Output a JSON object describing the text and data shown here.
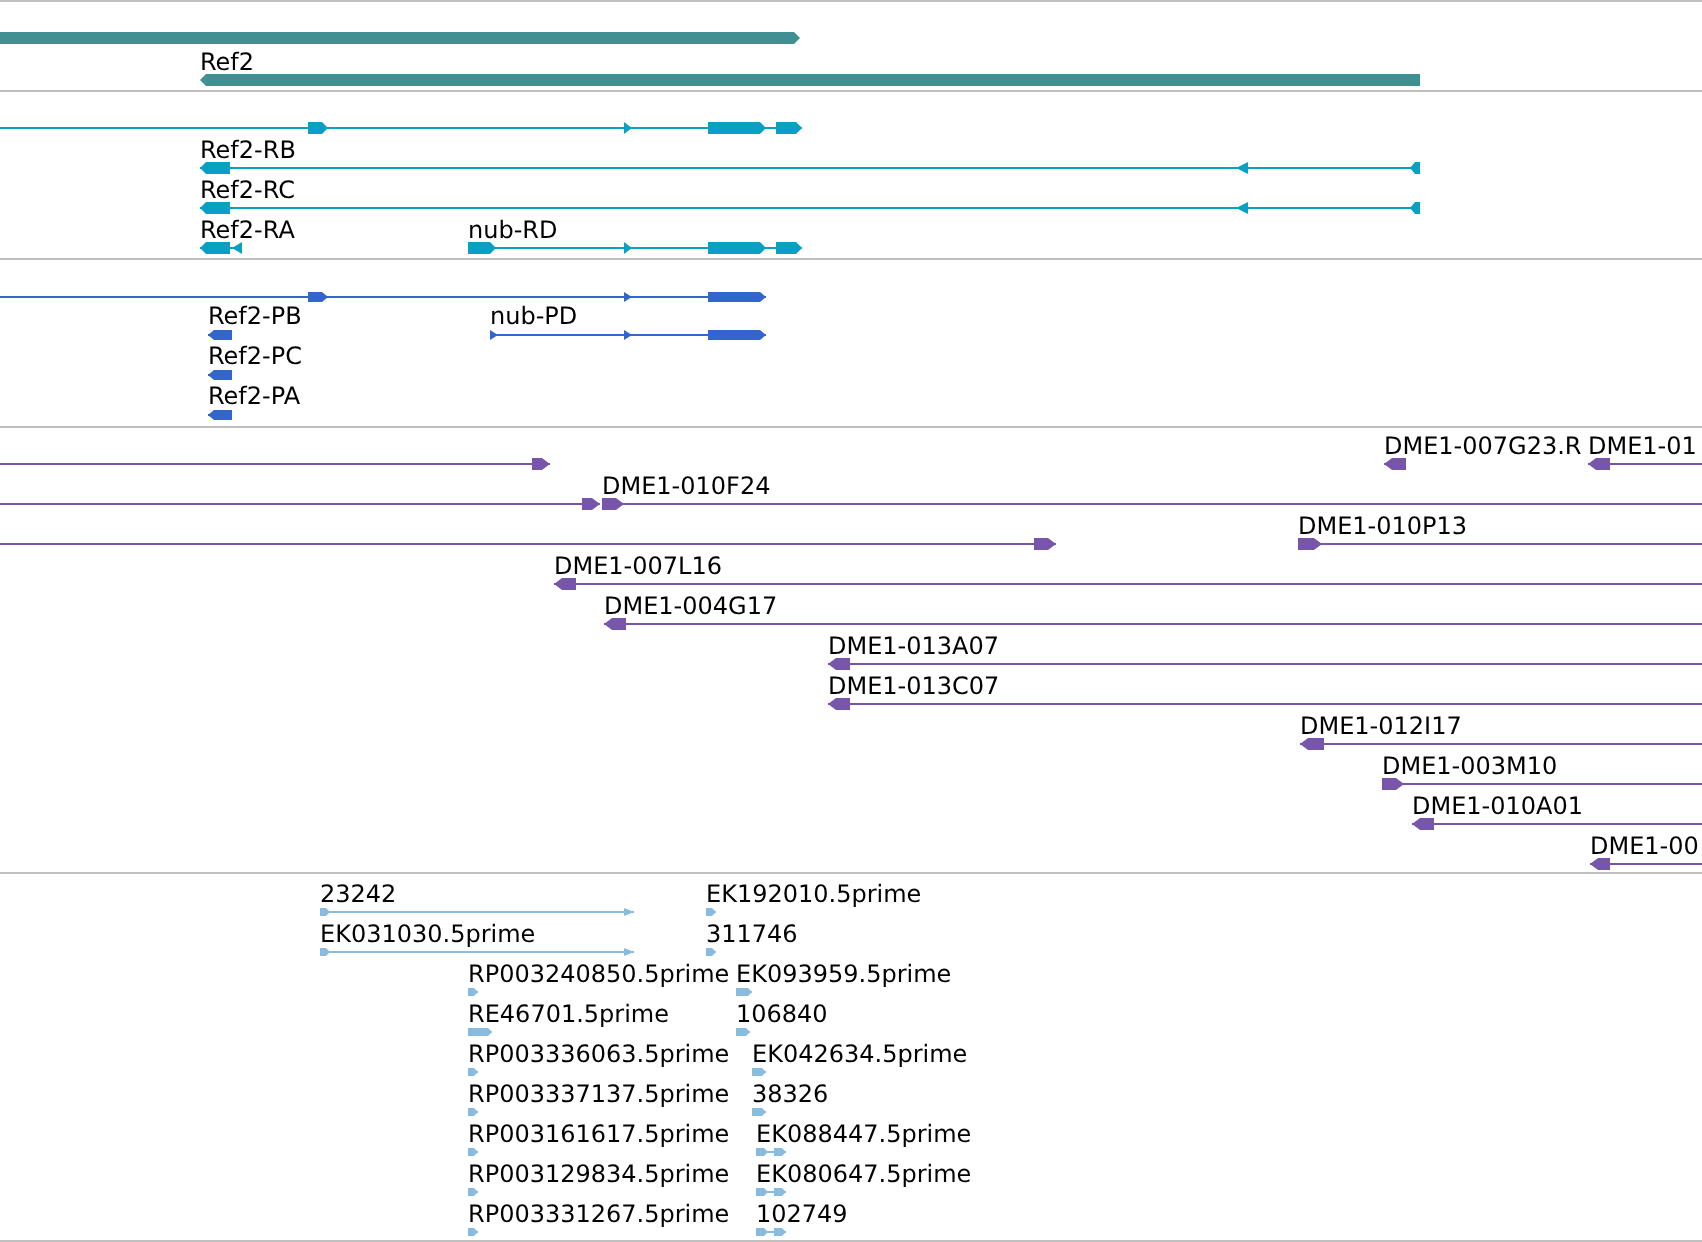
{
  "tracks": [
    {
      "kind": "gene",
      "color": "#408f93",
      "features": [
        {
          "reverse": false
        },
        {
          "label": "Ref2",
          "reverse": true
        }
      ]
    },
    {
      "kind": "transcript",
      "color": "#0aa0c4",
      "features": [
        {
          "reverse": false
        },
        {
          "label": "Ref2-RB",
          "reverse": true
        },
        {
          "label": "Ref2-RC",
          "reverse": true
        },
        {
          "label": "Ref2-RA",
          "reverse": true
        },
        {
          "label": "nub-RD",
          "reverse": false
        }
      ]
    },
    {
      "kind": "protein",
      "color": "#3366cc",
      "features": [
        {
          "reverse": false
        },
        {
          "label": "Ref2-PB",
          "reverse": true
        },
        {
          "label": "nub-PD",
          "reverse": false
        },
        {
          "label": "Ref2-PC",
          "reverse": true
        },
        {
          "label": "Ref2-PA",
          "reverse": true
        }
      ]
    },
    {
      "kind": "clone",
      "color": "#7755aa",
      "features": [
        {
          "reverse": false
        },
        {
          "label": "DME1-007G23.R",
          "reverse": true
        },
        {
          "label": "DME1-01",
          "reverse": true
        },
        {
          "reverse": false
        },
        {
          "label": "DME1-010F24",
          "reverse": false
        },
        {
          "reverse": false
        },
        {
          "label": "DME1-010P13",
          "reverse": false
        },
        {
          "label": "DME1-007L16",
          "reverse": true
        },
        {
          "label": "DME1-004G17",
          "reverse": true
        },
        {
          "label": "DME1-013A07",
          "reverse": true
        },
        {
          "label": "DME1-013C07",
          "reverse": true
        },
        {
          "label": "DME1-012I17",
          "reverse": true
        },
        {
          "label": "DME1-003M10",
          "reverse": false
        },
        {
          "label": "DME1-010A01",
          "reverse": true
        },
        {
          "label": "DME1-00",
          "reverse": true
        }
      ]
    },
    {
      "kind": "est",
      "color": "#88bbdd",
      "features": [
        {
          "label": "23242",
          "reverse": false
        },
        {
          "label": "EK192010.5prime",
          "reverse": false
        },
        {
          "label": "EK031030.5prime",
          "reverse": false
        },
        {
          "label": "311746",
          "reverse": false
        },
        {
          "label": "RP003240850.5prime",
          "reverse": false
        },
        {
          "label": "EK093959.5prime",
          "reverse": false
        },
        {
          "label": "RE46701.5prime",
          "reverse": false
        },
        {
          "label": "106840",
          "reverse": false
        },
        {
          "label": "RP003336063.5prime",
          "reverse": false
        },
        {
          "label": "EK042634.5prime",
          "reverse": false
        },
        {
          "label": "RP003337137.5prime",
          "reverse": false
        },
        {
          "label": "38326",
          "reverse": false
        },
        {
          "label": "RP003161617.5prime",
          "reverse": false
        },
        {
          "label": "EK088447.5prime",
          "reverse": false
        },
        {
          "label": "RP003129834.5prime",
          "reverse": false
        },
        {
          "label": "EK080647.5prime",
          "reverse": false
        },
        {
          "label": "RP003331267.5prime",
          "reverse": false
        },
        {
          "label": "102749",
          "reverse": false
        }
      ]
    }
  ]
}
